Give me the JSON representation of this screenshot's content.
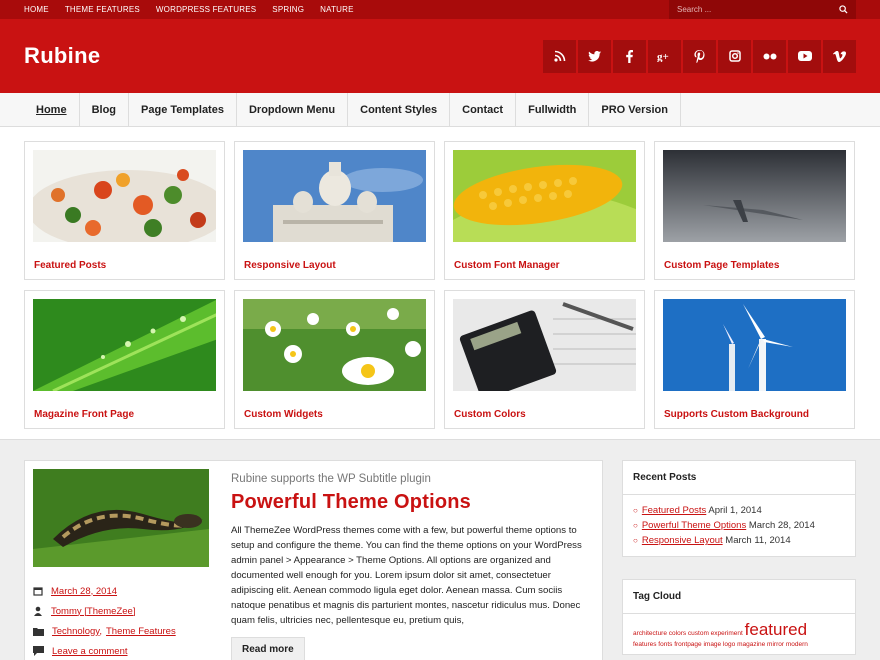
{
  "topbar": {
    "links": [
      "HOME",
      "THEME FEATURES",
      "WORDPRESS FEATURES",
      "SPRING",
      "NATURE"
    ],
    "search_placeholder": "Search ..."
  },
  "header": {
    "site_title": "Rubine",
    "social": [
      "rss-icon",
      "twitter-icon",
      "facebook-icon",
      "google-plus-icon",
      "pinterest-icon",
      "instagram-icon",
      "flickr-icon",
      "youtube-icon",
      "vimeo-icon"
    ]
  },
  "nav": {
    "items": [
      "Home",
      "Blog",
      "Page Templates",
      "Dropdown Menu",
      "Content Styles",
      "Contact",
      "Fullwidth",
      "PRO Version"
    ]
  },
  "featured": [
    {
      "title": "Featured Posts"
    },
    {
      "title": "Responsive Layout"
    },
    {
      "title": "Custom Font Manager"
    },
    {
      "title": "Custom Page Templates"
    },
    {
      "title": "Magazine Front Page"
    },
    {
      "title": "Custom Widgets"
    },
    {
      "title": "Custom Colors"
    },
    {
      "title": "Supports Custom Background"
    }
  ],
  "post": {
    "subtitle": "Rubine supports the WP Subtitle plugin",
    "title": "Powerful Theme Options",
    "date": "March 28, 2014",
    "author": "Tommy [ThemeZee]",
    "cat1": "Technology,",
    "cat2": "Theme Features",
    "comment": "Leave a comment",
    "excerpt": "All ThemeZee WordPress themes come with a few, but powerful theme options to setup and configure the theme. You can find the theme options on your WordPress admin panel > Appearance > Theme Options. All options are organized and documented well enough for you. Lorem ipsum dolor sit amet, consectetuer adipiscing elit. Aenean commodo ligula eget dolor. Aenean massa. Cum sociis natoque penatibus et magnis dis parturient montes, nascetur ridiculus mus. Donec quam felis, ultricies nec, pellentesque eu, pretium quis,",
    "read_more": "Read more"
  },
  "sidebar": {
    "recent_title": "Recent Posts",
    "recent": [
      {
        "link": "Featured Posts",
        "date": "April 1, 2014"
      },
      {
        "link": "Powerful Theme Options",
        "date": "March 28, 2014"
      },
      {
        "link": "Responsive Layout",
        "date": "March 11, 2014"
      }
    ],
    "tag_title": "Tag Cloud",
    "tags_line1": "architecture colors custom experiment",
    "tags_big": "featured",
    "tags_line2": "features fonts frontpage image logo magazine mirror modern"
  },
  "colors": {
    "accent": "#c91212",
    "topbar": "#a80b0b"
  }
}
